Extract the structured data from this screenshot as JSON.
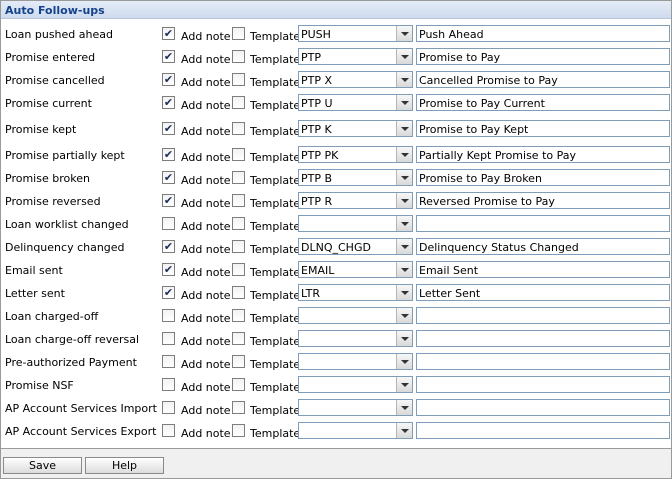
{
  "panel": {
    "title": "Auto Follow-ups"
  },
  "labels": {
    "add_note": "Add note",
    "template": "Template"
  },
  "rows": [
    {
      "label": "Loan pushed ahead",
      "add_note": true,
      "template": false,
      "code": "PUSH",
      "description": "Push Ahead"
    },
    {
      "label": "Promise entered",
      "add_note": true,
      "template": false,
      "code": "PTP",
      "description": "Promise to Pay"
    },
    {
      "label": "Promise cancelled",
      "add_note": true,
      "template": false,
      "code": "PTP X",
      "description": "Cancelled Promise to Pay"
    },
    {
      "label": "Promise current",
      "add_note": true,
      "template": false,
      "code": "PTP U",
      "description": "Promise to Pay Current"
    },
    {
      "label": "Promise kept",
      "add_note": true,
      "template": false,
      "code": "PTP K",
      "description": "Promise to Pay Kept"
    },
    {
      "label": "Promise partially kept",
      "add_note": true,
      "template": false,
      "code": "PTP PK",
      "description": "Partially Kept Promise to Pay"
    },
    {
      "label": "Promise broken",
      "add_note": true,
      "template": false,
      "code": "PTP B",
      "description": "Promise to Pay Broken"
    },
    {
      "label": "Promise reversed",
      "add_note": true,
      "template": false,
      "code": "PTP R",
      "description": "Reversed Promise to Pay"
    },
    {
      "label": "Loan worklist changed",
      "add_note": false,
      "template": false,
      "code": "",
      "description": ""
    },
    {
      "label": "Delinquency changed",
      "add_note": true,
      "template": false,
      "code": "DLNQ_CHGD",
      "description": "Delinquency Status Changed"
    },
    {
      "label": "Email sent",
      "add_note": true,
      "template": false,
      "code": "EMAIL",
      "description": "Email Sent"
    },
    {
      "label": "Letter sent",
      "add_note": true,
      "template": false,
      "code": "LTR",
      "description": "Letter Sent"
    },
    {
      "label": "Loan charged-off",
      "add_note": false,
      "template": false,
      "code": "",
      "description": ""
    },
    {
      "label": "Loan charge-off reversal",
      "add_note": false,
      "template": false,
      "code": "",
      "description": ""
    },
    {
      "label": "Pre-authorized Payment",
      "add_note": false,
      "template": false,
      "code": "",
      "description": ""
    },
    {
      "label": "Promise NSF",
      "add_note": false,
      "template": false,
      "code": "",
      "description": ""
    },
    {
      "label": "AP Account Services Import",
      "add_note": false,
      "template": false,
      "code": "",
      "description": ""
    },
    {
      "label": "AP Account Services Export",
      "add_note": false,
      "template": false,
      "code": "",
      "description": ""
    }
  ],
  "buttons": {
    "save": "Save",
    "help": "Help"
  },
  "colors": {
    "header_text": "#15428b",
    "header_bg": "#cfdcee",
    "input_border": "#7f9db9"
  },
  "icons": {
    "dropdown": "chevron-down-icon",
    "checked": "check-icon"
  }
}
